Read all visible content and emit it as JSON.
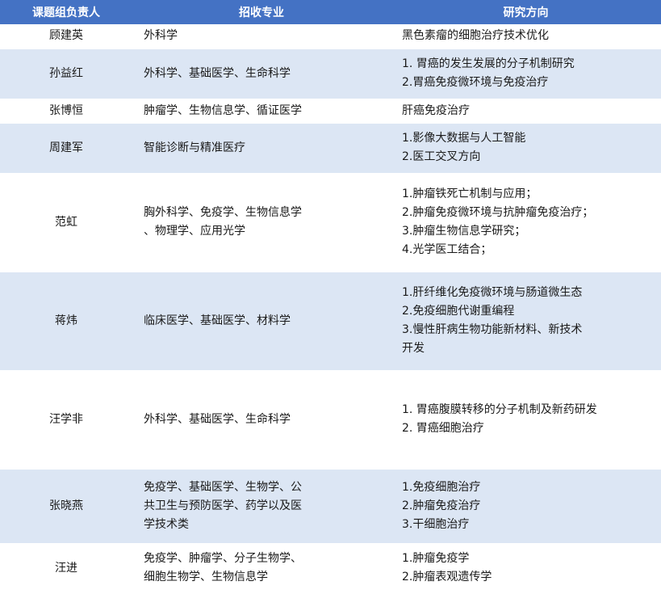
{
  "headers": [
    "课题组负责人",
    "招收专业",
    "研究方向"
  ],
  "rows": [
    {
      "leader": "顾建英",
      "majors": [
        "外科学"
      ],
      "directions": [
        "黑色素瘤的细胞治疗技术优化"
      ]
    },
    {
      "leader": "孙益红",
      "majors": [
        "外科学、基础医学、生命科学"
      ],
      "directions": [
        "1. 胃癌的发生发展的分子机制研究",
        "2.胃癌免疫微环境与免疫治疗"
      ]
    },
    {
      "leader": "张博恒",
      "majors": [
        "肿瘤学、生物信息学、循证医学"
      ],
      "directions": [
        "肝癌免疫治疗"
      ]
    },
    {
      "leader": "周建军",
      "majors": [
        "智能诊断与精准医疗"
      ],
      "directions": [
        "1.影像大数据与人工智能",
        "2.医工交叉方向"
      ]
    },
    {
      "leader": "范虹",
      "majors": [
        "胸外科学、免疫学、生物信息学",
        "、物理学、应用光学"
      ],
      "directions": [
        "1.肿瘤铁死亡机制与应用；",
        "2.肿瘤免疫微环境与抗肿瘤免疫治疗；",
        "3.肿瘤生物信息学研究；",
        "4.光学医工结合；"
      ]
    },
    {
      "leader": "蒋炜",
      "majors": [
        "临床医学、基础医学、材料学"
      ],
      "directions": [
        "1.肝纤维化免疫微环境与肠道微生态",
        "2.免疫细胞代谢重编程",
        "3.慢性肝病生物功能新材料、新技术",
        "开发"
      ]
    },
    {
      "leader": "汪学非",
      "majors": [
        "外科学、基础医学、生命科学"
      ],
      "directions": [
        "1. 胃癌腹膜转移的分子机制及新药研发",
        "2. 胃癌细胞治疗"
      ]
    },
    {
      "leader": "张晓燕",
      "majors": [
        "免疫学、基础医学、生物学、公",
        "共卫生与预防医学、药学以及医",
        "学技术类"
      ],
      "directions": [
        "1.免疫细胞治疗",
        "2.肿瘤免疫治疗",
        "3.干细胞治疗"
      ]
    },
    {
      "leader": "汪进",
      "majors": [
        "免疫学、肿瘤学、分子生物学、",
        "细胞生物学、生物信息学"
      ],
      "directions": [
        "1.肿瘤免疫学",
        "2.肿瘤表观遗传学"
      ]
    }
  ]
}
